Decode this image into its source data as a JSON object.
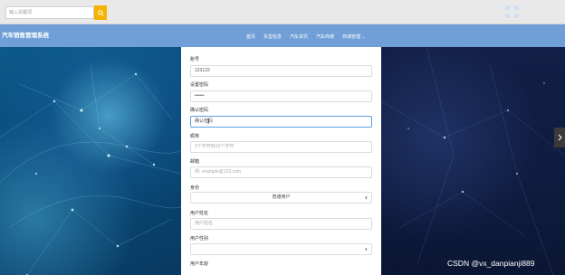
{
  "search": {
    "placeholder": "输入关键词"
  },
  "brand": "汽车销售管理系统",
  "nav": [
    "首页",
    "车型信息",
    "汽车资讯",
    "汽车商城",
    "商城管理"
  ],
  "form": {
    "account": {
      "label": "账号",
      "value": "123123"
    },
    "password": {
      "label": "设置密码",
      "value": "••••••"
    },
    "confirm": {
      "label": "确认密码",
      "value": "确认密码"
    },
    "nickname": {
      "label": "昵称",
      "placeholder": "2个字符到10个字符"
    },
    "email": {
      "label": "邮箱",
      "placeholder": "例: example@123.com"
    },
    "identity": {
      "label": "身份",
      "value": "普通用户"
    },
    "username": {
      "label": "用户姓名",
      "placeholder": "用户姓名"
    },
    "gender": {
      "label": "用户性别",
      "value": ""
    },
    "age": {
      "label": "用户年龄"
    }
  },
  "watermark": "CSDN @vx_danpianji889",
  "colors": {
    "nav": "#6f9fd6",
    "search_button": "#f5b300",
    "focus_border": "#5a9de0"
  },
  "icons": [
    "search-icon",
    "chevron-down-icon",
    "chevron-right-icon",
    "text-cursor-icon"
  ]
}
